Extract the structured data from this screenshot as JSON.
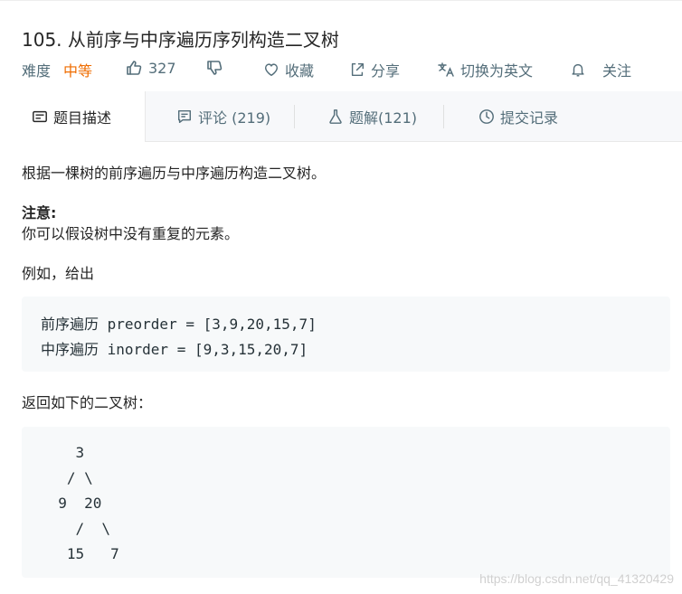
{
  "problem": {
    "title": "105. 从前序与中序遍历序列构造二叉树",
    "difficulty_label": "难度",
    "difficulty_value": "中等",
    "likes": "327",
    "favorite_label": "收藏",
    "share_label": "分享",
    "translate_label": "切换为英文",
    "follow_label": "关注"
  },
  "tabs": [
    {
      "label": "题目描述",
      "icon": "description-icon"
    },
    {
      "label": "评论 (219)",
      "icon": "comment-icon"
    },
    {
      "label": "题解(121)",
      "icon": "flask-icon"
    },
    {
      "label": "提交记录",
      "icon": "clock-icon"
    }
  ],
  "content": {
    "intro": "根据一棵树的前序遍历与中序遍历构造二叉树。",
    "note_label": "注意:",
    "note_text": "你可以假设树中没有重复的元素。",
    "example_label": "例如，给出",
    "example_lines": [
      "前序遍历 preorder = [3,9,20,15,7]",
      "中序遍历 inorder = [9,3,15,20,7]"
    ],
    "return_label": "返回如下的二叉树：",
    "tree_lines": [
      "    3",
      "   / \\",
      "  9  20",
      "    /  \\",
      "   15   7"
    ]
  },
  "watermark": "https://blog.csdn.net/qq_41320429",
  "colors": {
    "accent_difficulty": "#ef6c00",
    "meta_text": "#546e7a",
    "code_background": "#f7f9fa"
  }
}
